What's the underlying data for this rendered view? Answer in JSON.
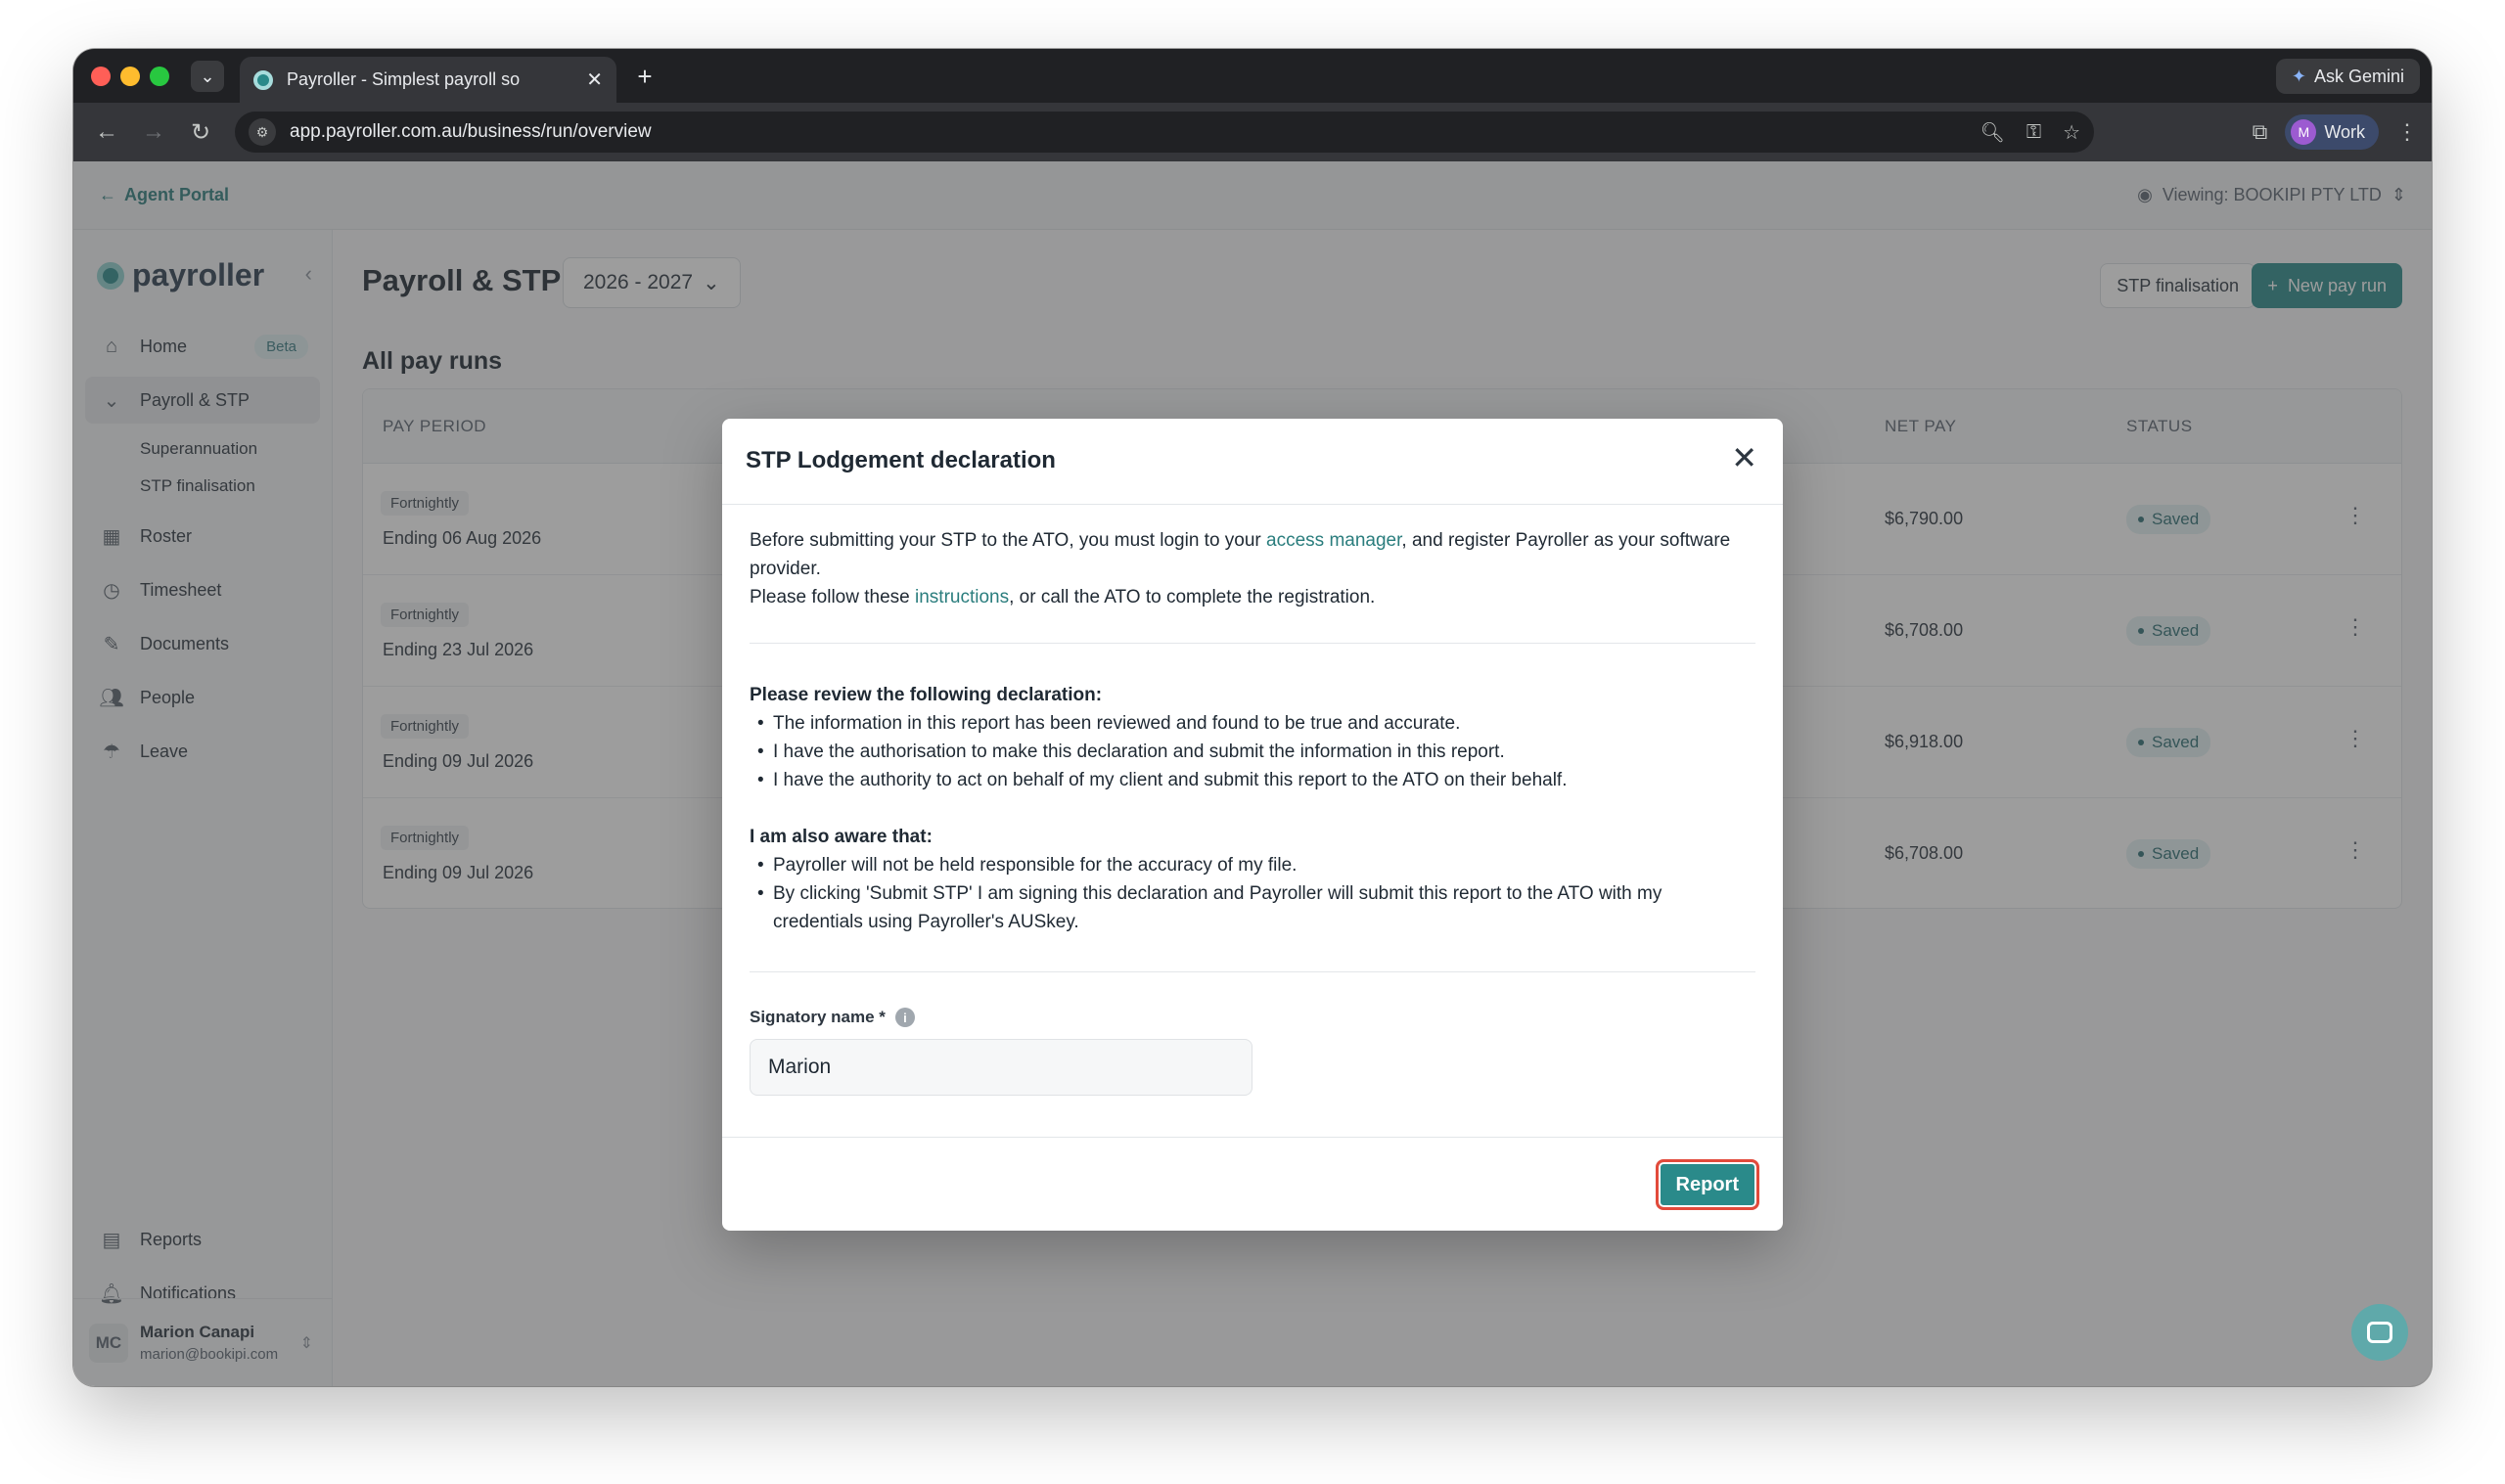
{
  "browser": {
    "tab_title": "Payroller - Simplest payroll so",
    "url": "app.payroller.com.au/business/run/overview",
    "gemini_label": "Ask Gemini",
    "profile_initial": "M",
    "profile_label": "Work"
  },
  "agentbar": {
    "back_label": "Agent Portal",
    "viewing_label": "Viewing: BOOKIPI PTY LTD"
  },
  "sidebar": {
    "logo_text": "payroller",
    "items": [
      {
        "label": "Home",
        "badge": "Beta",
        "icon": "home-icon"
      },
      {
        "label": "Payroll & STP",
        "icon": "chevron-down-icon"
      },
      {
        "label": "Roster",
        "icon": "calendar-icon"
      },
      {
        "label": "Timesheet",
        "icon": "timesheet-icon"
      },
      {
        "label": "Documents",
        "icon": "document-icon"
      },
      {
        "label": "People",
        "icon": "people-icon"
      },
      {
        "label": "Leave",
        "icon": "leave-icon"
      }
    ],
    "sub_items": [
      "Superannuation",
      "STP finalisation"
    ],
    "bottom_items": [
      {
        "label": "Reports",
        "icon": "report-icon"
      },
      {
        "label": "Notifications",
        "icon": "bell-icon"
      }
    ],
    "user": {
      "initials": "MC",
      "name": "Marion Canapi",
      "email": "marion@bookipi.com"
    }
  },
  "main": {
    "title": "Payroll & STP",
    "year": "2026 - 2027",
    "stp_finalisation_btn": "STP finalisation",
    "new_pay_run_btn": "New pay run",
    "section_title": "All pay runs",
    "columns": {
      "pay_period": "PAY PERIOD",
      "net_pay": "NET PAY",
      "status": "STATUS"
    },
    "rows": [
      {
        "frequency": "Fortnightly",
        "ending": "Ending 06 Aug 2026",
        "net_pay": "$6,790.00",
        "status": "Saved"
      },
      {
        "frequency": "Fortnightly",
        "ending": "Ending 23 Jul 2026",
        "net_pay": "$6,708.00",
        "status": "Saved"
      },
      {
        "frequency": "Fortnightly",
        "ending": "Ending 09 Jul 2026",
        "net_pay": "$6,918.00",
        "status": "Saved"
      },
      {
        "frequency": "Fortnightly",
        "ending": "Ending 09 Jul 2026",
        "net_pay": "$6,708.00",
        "status": "Saved"
      }
    ]
  },
  "modal": {
    "title": "STP Lodgement declaration",
    "intro_1a": "Before submitting your STP to the ATO, you must login to your ",
    "intro_link_1": "access manager",
    "intro_1b": ", and register Payroller as your software provider.",
    "intro_2a": "Please follow these ",
    "intro_link_2": "instructions",
    "intro_2b": ", or call the ATO to complete the registration.",
    "declaration_heading": "Please review the following declaration:",
    "declarations": [
      "The information in this report has been reviewed and found to be true and accurate.",
      "I have the authorisation to make this declaration and submit the information in this report.",
      "I have the authority to act on behalf of my client and submit this report to the ATO on their behalf."
    ],
    "aware_heading": "I am also aware that:",
    "aware_items": [
      "Payroller will not be held responsible for the accuracy of my file.",
      "By clicking 'Submit STP' I am signing this declaration and Payroller will submit this report to the ATO with my credentials using Payroller's AUSkey."
    ],
    "signatory_label": "Signatory name *",
    "signatory_value": "Marion",
    "report_btn": "Report"
  }
}
